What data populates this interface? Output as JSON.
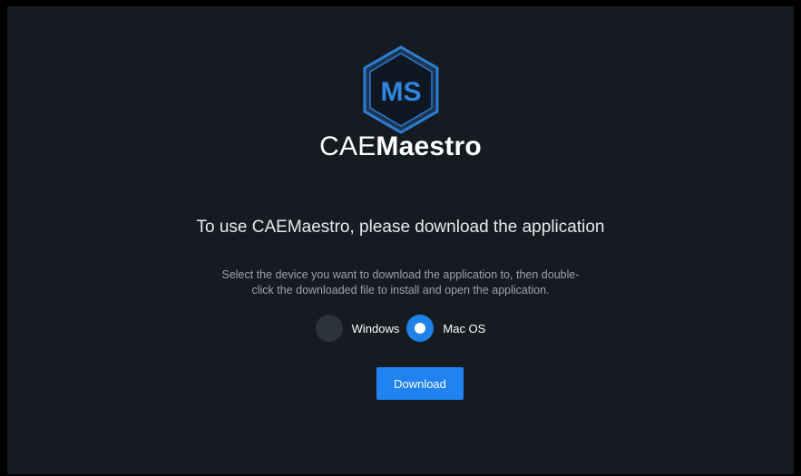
{
  "brand": {
    "logo_text": "MS",
    "name_light": "CAE",
    "name_bold": "Maestro"
  },
  "heading": "To use CAEMaestro, please download the application",
  "description": {
    "line1": "Select the device you want to download the application to, then double-",
    "line2": "click the downloaded file to install and open the application."
  },
  "device_options": [
    {
      "label": "Windows",
      "selected": false
    },
    {
      "label": "Mac OS",
      "selected": true
    }
  ],
  "download_label": "Download",
  "colors": {
    "background": "#161b22",
    "accent": "#1f82f0",
    "logo_blue": "#2a7fd4"
  }
}
